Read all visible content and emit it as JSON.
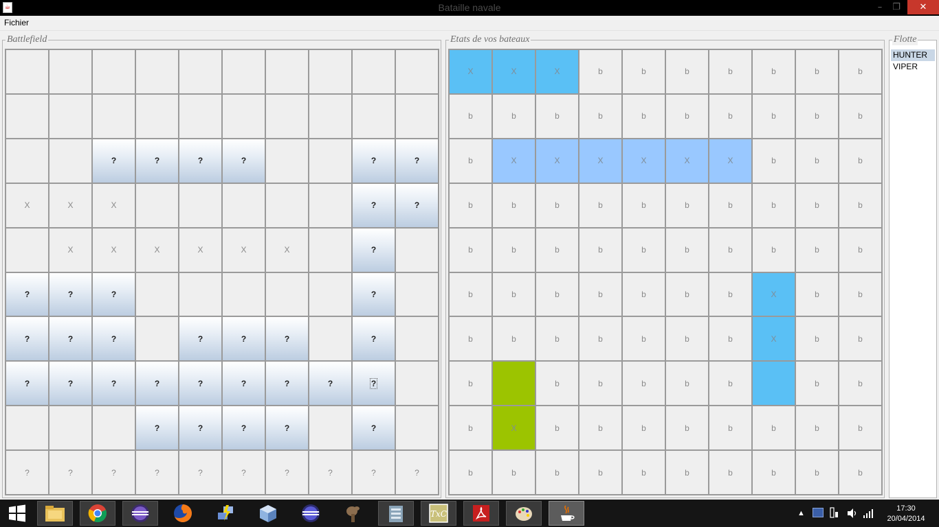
{
  "window": {
    "title": "Bataille navale",
    "min": "–",
    "max": "❐",
    "close": "✕",
    "icon": "java-icon"
  },
  "menubar": {
    "fichier": "Fichier"
  },
  "battlefield": {
    "legend": "Battlefield",
    "rows": [
      [
        "",
        "",
        "",
        "",
        "",
        "",
        "",
        "",
        "",
        ""
      ],
      [
        "",
        "",
        "",
        "",
        "",
        "",
        "",
        "",
        "",
        ""
      ],
      [
        "",
        "",
        "?",
        "?",
        "?",
        "?",
        "",
        "",
        "?",
        "?"
      ],
      [
        "X",
        "X",
        "X",
        "",
        "",
        "",
        "",
        "",
        "?",
        "?"
      ],
      [
        "",
        "X",
        "X",
        "X",
        "X",
        "X",
        "X",
        "",
        "?",
        ""
      ],
      [
        "?",
        "?",
        "?",
        "",
        "",
        "",
        "",
        "",
        "?",
        ""
      ],
      [
        "?",
        "?",
        "?",
        "",
        "?",
        "?",
        "?",
        "",
        "?",
        ""
      ],
      [
        "?",
        "?",
        "?",
        "?",
        "?",
        "?",
        "?",
        "?",
        "?",
        ""
      ],
      [
        "",
        "",
        "",
        "?",
        "?",
        "?",
        "?",
        "",
        "?",
        ""
      ],
      [
        "?",
        "?",
        "?",
        "?",
        "?",
        "?",
        "?",
        "?",
        "?",
        "?"
      ]
    ],
    "fog": [
      [
        0,
        0,
        0,
        0,
        0,
        0,
        0,
        0,
        0,
        0
      ],
      [
        0,
        0,
        0,
        0,
        0,
        0,
        0,
        0,
        0,
        0
      ],
      [
        0,
        0,
        1,
        1,
        1,
        1,
        0,
        0,
        1,
        1
      ],
      [
        0,
        0,
        0,
        0,
        0,
        0,
        0,
        0,
        1,
        1
      ],
      [
        0,
        0,
        0,
        0,
        0,
        0,
        0,
        0,
        1,
        0
      ],
      [
        1,
        1,
        1,
        0,
        0,
        0,
        0,
        0,
        1,
        0
      ],
      [
        1,
        1,
        1,
        0,
        1,
        1,
        1,
        0,
        1,
        0
      ],
      [
        1,
        1,
        1,
        1,
        1,
        1,
        1,
        1,
        1,
        0
      ],
      [
        0,
        0,
        0,
        1,
        1,
        1,
        1,
        0,
        1,
        0
      ],
      [
        0,
        0,
        0,
        0,
        0,
        0,
        0,
        0,
        0,
        0
      ]
    ],
    "focused_cell": [
      7,
      8
    ]
  },
  "boats": {
    "legend": "Etats de vos bateaux",
    "rows": [
      [
        "X",
        "X",
        "X",
        "b",
        "b",
        "b",
        "b",
        "b",
        "b",
        "b"
      ],
      [
        "b",
        "b",
        "b",
        "b",
        "b",
        "b",
        "b",
        "b",
        "b",
        "b"
      ],
      [
        "b",
        "X",
        "X",
        "X",
        "X",
        "X",
        "X",
        "b",
        "b",
        "b"
      ],
      [
        "b",
        "b",
        "b",
        "b",
        "b",
        "b",
        "b",
        "b",
        "b",
        "b"
      ],
      [
        "b",
        "b",
        "b",
        "b",
        "b",
        "b",
        "b",
        "b",
        "b",
        "b"
      ],
      [
        "b",
        "b",
        "b",
        "b",
        "b",
        "b",
        "b",
        "X",
        "b",
        "b"
      ],
      [
        "b",
        "b",
        "b",
        "b",
        "b",
        "b",
        "b",
        "X",
        "b",
        "b"
      ],
      [
        "b",
        "",
        "b",
        "b",
        "b",
        "b",
        "b",
        "",
        "b",
        "b"
      ],
      [
        "b",
        "X",
        "b",
        "b",
        "b",
        "b",
        "b",
        "b",
        "b",
        "b"
      ],
      [
        "b",
        "b",
        "b",
        "b",
        "b",
        "b",
        "b",
        "b",
        "b",
        "b"
      ]
    ],
    "colors": [
      [
        1,
        1,
        1,
        0,
        0,
        0,
        0,
        0,
        0,
        0
      ],
      [
        0,
        0,
        0,
        0,
        0,
        0,
        0,
        0,
        0,
        0
      ],
      [
        0,
        2,
        2,
        2,
        2,
        2,
        2,
        0,
        0,
        0
      ],
      [
        0,
        0,
        0,
        0,
        0,
        0,
        0,
        0,
        0,
        0
      ],
      [
        0,
        0,
        0,
        0,
        0,
        0,
        0,
        0,
        0,
        0
      ],
      [
        0,
        0,
        0,
        0,
        0,
        0,
        0,
        1,
        0,
        0
      ],
      [
        0,
        0,
        0,
        0,
        0,
        0,
        0,
        1,
        0,
        0
      ],
      [
        0,
        3,
        0,
        0,
        0,
        0,
        0,
        1,
        0,
        0
      ],
      [
        0,
        3,
        0,
        0,
        0,
        0,
        0,
        0,
        0,
        0
      ],
      [
        0,
        0,
        0,
        0,
        0,
        0,
        0,
        0,
        0,
        0
      ]
    ],
    "palette": {
      "1": "#5ac0f5",
      "2": "#99c8ff",
      "3": "#9cc400"
    }
  },
  "fleet": {
    "legend": "Flotte",
    "items": [
      {
        "label": "HUNTER",
        "selected": true
      },
      {
        "label": "VIPER",
        "selected": false
      }
    ]
  },
  "taskbar": {
    "apps": [
      "start-icon",
      "file-explorer-icon",
      "chrome-icon",
      "eclipse-icon",
      "firefox-icon",
      "network-tool-icon",
      "virtualbox-icon",
      "eclipse-blue-icon",
      "gimp-icon",
      "file-manager-icon",
      "texmaker-icon",
      "acrobat-icon",
      "paint-icon",
      "java-icon"
    ],
    "clock_time": "17:30",
    "clock_date": "20/04/2014"
  }
}
